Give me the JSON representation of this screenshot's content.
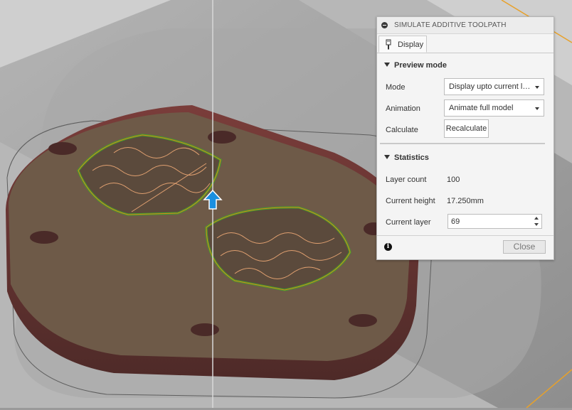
{
  "panel": {
    "title": "SIMULATE ADDITIVE TOOLPATH",
    "tab": {
      "label": "Display"
    },
    "preview_mode": {
      "heading": "Preview mode",
      "mode_label": "Mode",
      "mode_value": "Display upto current layer",
      "animation_label": "Animation",
      "animation_value": "Animate full model",
      "calculate_label": "Calculate",
      "recalculate_button": "Recalculate"
    },
    "statistics": {
      "heading": "Statistics",
      "layer_count_label": "Layer count",
      "layer_count_value": "100",
      "current_height_label": "Current height",
      "current_height_value": "17.250mm",
      "current_layer_label": "Current layer",
      "current_layer_value": "69"
    },
    "close_button": "Close"
  },
  "icons": {
    "collapse": "minus-circle-icon",
    "tab": "paint-brush-icon",
    "info": "info-icon",
    "move_handle": "up-arrow-icon"
  },
  "colors": {
    "part_body": "#6b3a35",
    "part_top": "#6e5a48",
    "toolpath_outer": "#e0781e",
    "toolpath_green": "#3aa82a",
    "manipulator": "#1a8fe0",
    "bed": "#a7a7a7"
  }
}
